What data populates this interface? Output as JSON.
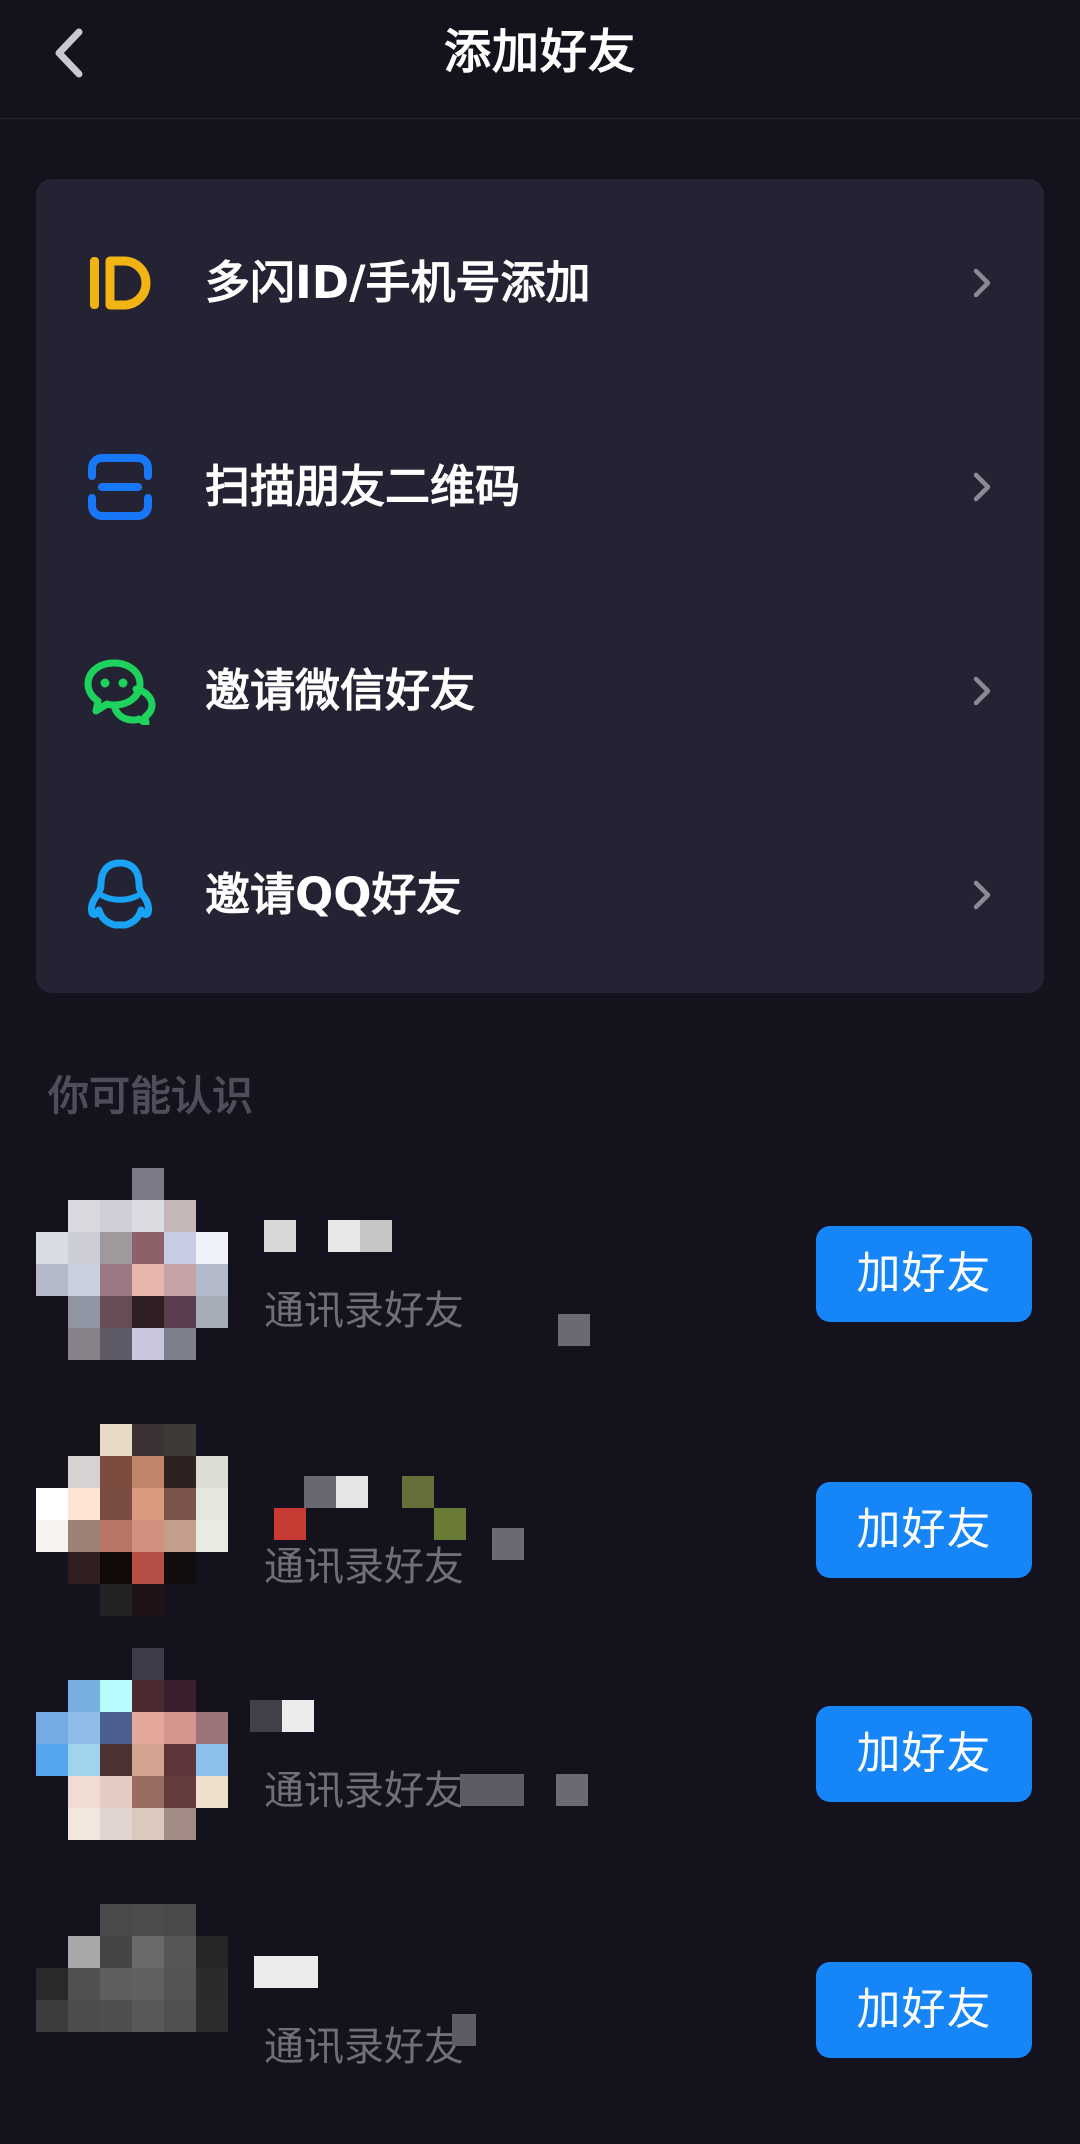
{
  "header": {
    "title": "添加好友",
    "back_icon": "chevron-left-icon"
  },
  "options": [
    {
      "label": "多闪ID/手机号添加",
      "icon": "id-icon",
      "color": "#f2b413"
    },
    {
      "label": "扫描朋友二维码",
      "icon": "scan-icon",
      "color": "#1877f6"
    },
    {
      "label": "邀请微信好友",
      "icon": "wechat-icon",
      "color": "#1ed35d"
    },
    {
      "label": "邀请QQ好友",
      "icon": "qq-icon",
      "color": "#1aa3f5"
    }
  ],
  "suggest": {
    "title": "你可能认识",
    "friends": [
      {
        "subtitle": "通讯录好友",
        "button": "加好友"
      },
      {
        "subtitle": "通讯录好友",
        "button": "加好友"
      },
      {
        "subtitle": "通讯录好友",
        "button": "加好友"
      },
      {
        "subtitle": "通讯录好友",
        "button": "加好友"
      }
    ]
  },
  "colors": {
    "background": "#13121d",
    "card": "#242333",
    "accent": "#1685f7",
    "muted": "#6f6e79"
  }
}
